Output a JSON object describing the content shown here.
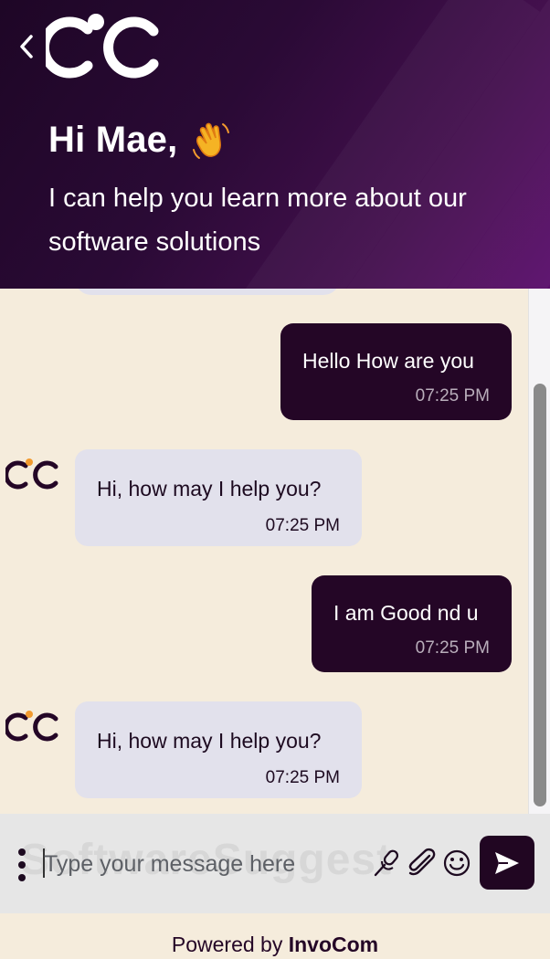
{
  "header": {
    "greeting": "Hi Mae,",
    "greeting_icon": "waving-hand-emoji",
    "subtitle": "I can help you learn more about our software solutions",
    "logo": "oc-logo"
  },
  "messages": [
    {
      "from": "user",
      "text": "Hello How are you",
      "time": "07:25 PM"
    },
    {
      "from": "bot",
      "text": "Hi, how may I help you?",
      "time": "07:25 PM"
    },
    {
      "from": "user",
      "text": "I am Good nd u",
      "time": "07:25 PM"
    },
    {
      "from": "bot",
      "text": "Hi, how may I help you?",
      "time": "07:25 PM"
    }
  ],
  "composer": {
    "placeholder": "Type your message here",
    "watermark": "SoftwareSuggest",
    "icons": [
      "microphone-icon",
      "paperclip-icon",
      "emoji-icon",
      "send-icon"
    ]
  },
  "footer": {
    "prefix": "Powered by ",
    "brand": "InvoCom"
  },
  "colors": {
    "header_start": "#1e0626",
    "header_end": "#5b0f6c",
    "user_bubble": "#240626",
    "bot_bubble": "#e2e1ec",
    "chat_background": "#f5ecdc",
    "logo_accent": "#f29a2e"
  }
}
